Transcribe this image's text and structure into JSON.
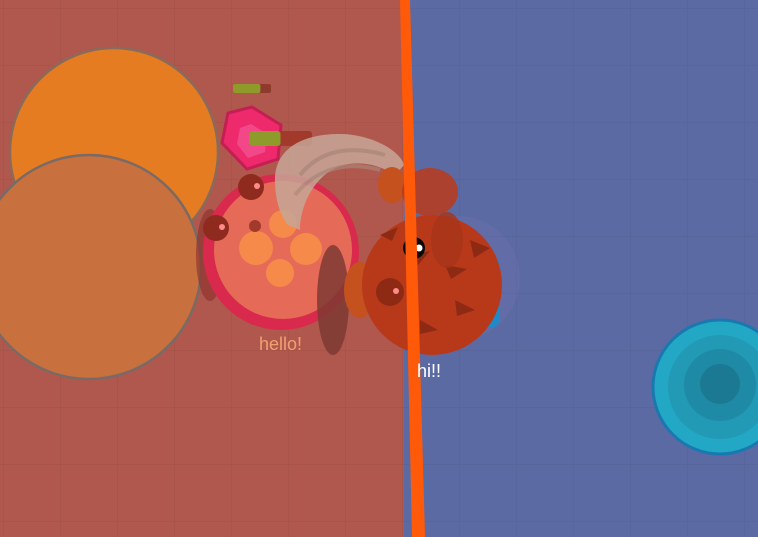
{
  "game": {
    "arena": {
      "left_zone_color": "#b0584d",
      "right_zone_color": "#5c6aa3",
      "border_color": "#ff5a0a",
      "grid_color": "#000000"
    },
    "entities": {
      "orange_boulder_color": "#e67c22",
      "tan_boulder_color": "#c8703e",
      "red_player_color": "#d9294c",
      "pink_pentagon_color": "#ef2a6c",
      "brown_crab_player_color": "#b8391a",
      "cyan_egg_color": "#22a8c4"
    },
    "health_bars": {
      "pentagon_health": 0.72,
      "red_player_health": 0.5
    },
    "chat": {
      "left_player": "hello!",
      "right_player": "hi!!"
    }
  }
}
